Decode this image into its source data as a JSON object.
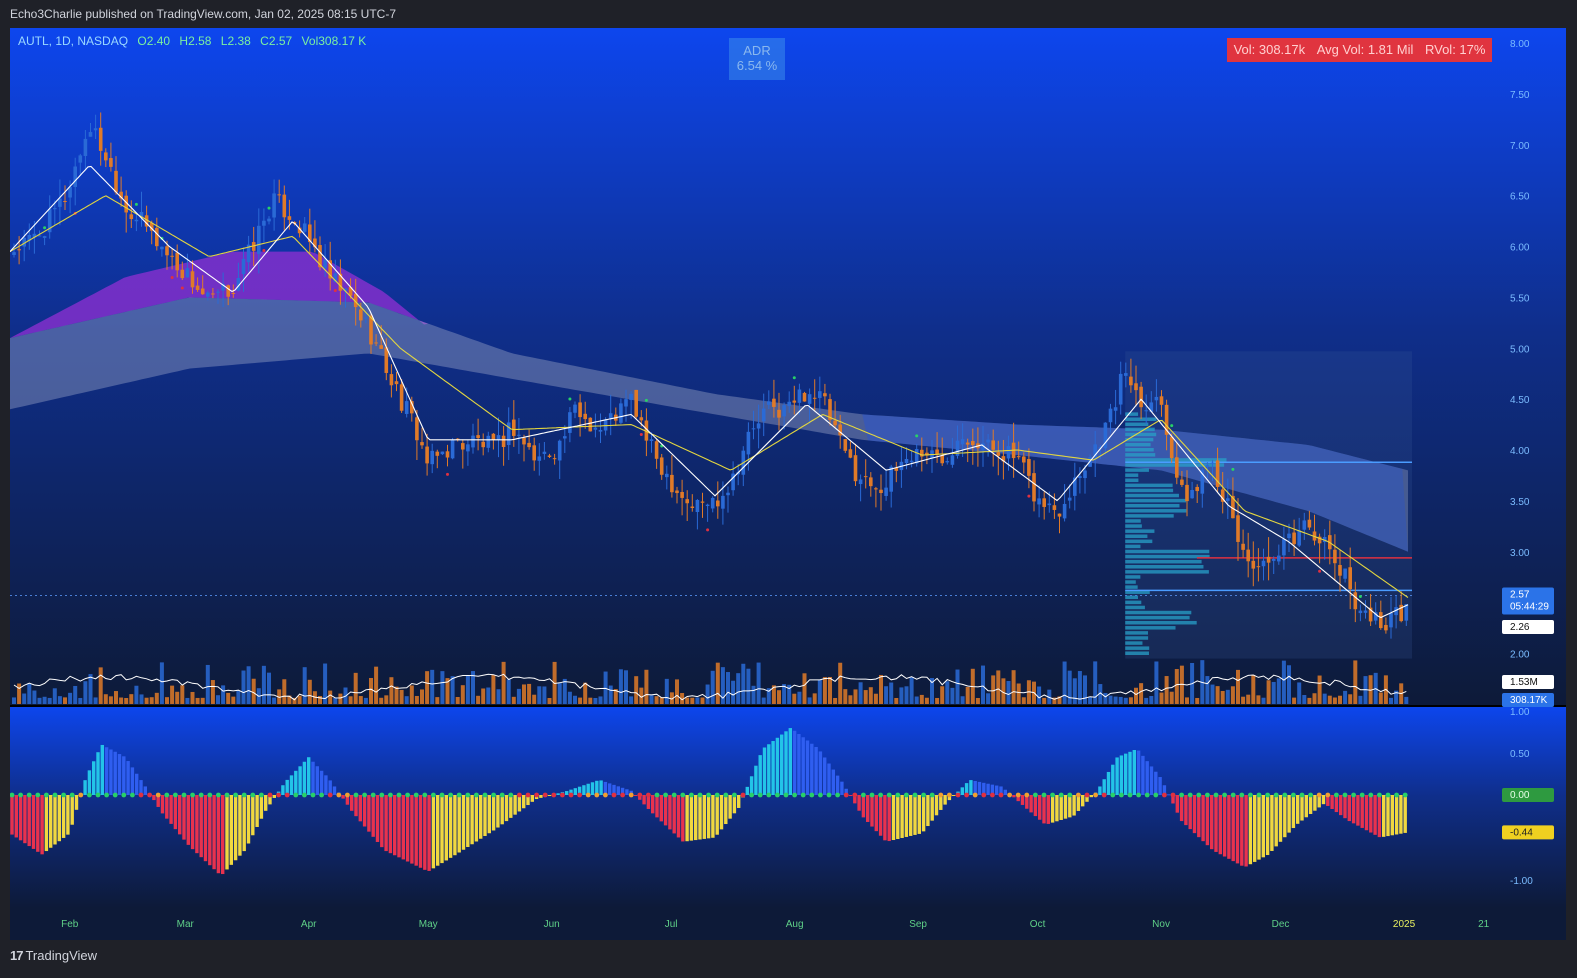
{
  "publisher": "Echo3Charlie published on TradingView.com, Jan 02, 2025 08:15 UTC-7",
  "legend": {
    "symbol": "AUTL, 1D, NASDAQ",
    "open": "O2.40",
    "high": "H2.58",
    "low": "L2.38",
    "close": "C2.57",
    "volume": "Vol308.17 K"
  },
  "adr": {
    "label": "ADR",
    "value": "6.54 %"
  },
  "volume_box": {
    "vol": "Vol: 308.17k",
    "avg": "Avg Vol: 1.81 Mil",
    "rvol": "RVol: 17%"
  },
  "footer": {
    "brand": "TradingView"
  },
  "colors": {
    "up": "#2a6ad6",
    "down": "#e07a28",
    "bg_top": "#0d46ee",
    "bg_bottom": "#0d1a38",
    "ema_fast": "#ffffff",
    "ema_slow": "#e3d640",
    "cloud_purple": "#8a2fd0",
    "cloud_grey": "#9ea8c8",
    "osc_cyan": "#23c4e8",
    "osc_blue": "#2f5ef0",
    "osc_red": "#e8324e",
    "osc_yellow": "#f0d840",
    "vol_profile": "#28a0c8",
    "line_blue": "#4a9cff",
    "line_red": "#e03040",
    "dot_green": "#28d068",
    "dot_red": "#e03040",
    "axis_text": "#7bbcff",
    "month_text": "#5fd088",
    "label_red_bg": "#e0343f"
  },
  "chart_data": [
    {
      "type": "candlestick",
      "title": "",
      "x_ticks": [
        "Feb",
        "Mar",
        "Apr",
        "May",
        "Jun",
        "Jul",
        "Aug",
        "Sep",
        "Oct",
        "Nov",
        "Dec",
        "2025",
        "21"
      ],
      "y_ticks": [
        "8.00",
        "7.50",
        "7.00",
        "6.50",
        "6.00",
        "5.50",
        "5.00",
        "4.50",
        "4.00",
        "3.50",
        "3.00",
        "2.00"
      ],
      "ylim": [
        1.5,
        8.0
      ],
      "price_labels": {
        "last": "2.57",
        "countdown": "05:44:29",
        "level": "2.26"
      },
      "volume_labels": {
        "avg": "1.53M",
        "last": "308.17K"
      },
      "close_path": [
        [
          "2024-01-17",
          5.95
        ],
        [
          "2024-01-22",
          6.05
        ],
        [
          "2024-01-26",
          6.2
        ],
        [
          "2024-01-31",
          6.5
        ],
        [
          "2024-02-06",
          7.2
        ],
        [
          "2024-02-10",
          6.9
        ],
        [
          "2024-02-15",
          6.4
        ],
        [
          "2024-02-20",
          6.2
        ],
        [
          "2024-02-26",
          5.9
        ],
        [
          "2024-03-02",
          5.7
        ],
        [
          "2024-03-07",
          5.45
        ],
        [
          "2024-03-13",
          5.6
        ],
        [
          "2024-03-19",
          6.1
        ],
        [
          "2024-03-23",
          6.45
        ],
        [
          "2024-03-28",
          6.3
        ],
        [
          "2024-04-02",
          6.0
        ],
        [
          "2024-04-06",
          5.7
        ],
        [
          "2024-04-11",
          5.5
        ],
        [
          "2024-04-16",
          5.2
        ],
        [
          "2024-04-20",
          4.85
        ],
        [
          "2024-04-24",
          4.5
        ],
        [
          "2024-04-28",
          4.2
        ],
        [
          "2024-05-01",
          3.85
        ],
        [
          "2024-05-07",
          4.05
        ],
        [
          "2024-05-13",
          4.1
        ],
        [
          "2024-05-18",
          4.0
        ],
        [
          "2024-05-22",
          4.25
        ],
        [
          "2024-05-28",
          3.9
        ],
        [
          "2024-06-03",
          4.05
        ],
        [
          "2024-06-07",
          4.4
        ],
        [
          "2024-06-13",
          4.2
        ],
        [
          "2024-06-17",
          4.35
        ],
        [
          "2024-06-21",
          4.5
        ],
        [
          "2024-06-26",
          4.0
        ],
        [
          "2024-07-01",
          3.7
        ],
        [
          "2024-07-06",
          3.45
        ],
        [
          "2024-07-12",
          3.5
        ],
        [
          "2024-07-16",
          3.7
        ],
        [
          "2024-07-20",
          4.1
        ],
        [
          "2024-07-25",
          4.4
        ],
        [
          "2024-07-30",
          4.4
        ],
        [
          "2024-08-04",
          4.6
        ],
        [
          "2024-08-08",
          4.5
        ],
        [
          "2024-08-13",
          4.0
        ],
        [
          "2024-08-18",
          3.7
        ],
        [
          "2024-08-24",
          3.65
        ],
        [
          "2024-08-28",
          3.9
        ],
        [
          "2024-09-02",
          4.0
        ],
        [
          "2024-09-07",
          3.9
        ],
        [
          "2024-09-12",
          4.2
        ],
        [
          "2024-09-17",
          4.05
        ],
        [
          "2024-09-22",
          4.0
        ],
        [
          "2024-09-26",
          3.9
        ],
        [
          "2024-10-01",
          3.5
        ],
        [
          "2024-10-06",
          3.4
        ],
        [
          "2024-10-10",
          3.7
        ],
        [
          "2024-10-15",
          4.0
        ],
        [
          "2024-10-19",
          4.3
        ],
        [
          "2024-10-23",
          4.8
        ],
        [
          "2024-10-27",
          4.5
        ],
        [
          "2024-11-01",
          4.5
        ],
        [
          "2024-11-06",
          3.55
        ],
        [
          "2024-11-10",
          3.6
        ],
        [
          "2024-11-13",
          4.0
        ],
        [
          "2024-11-18",
          3.4
        ],
        [
          "2024-11-22",
          2.95
        ],
        [
          "2024-11-28",
          2.8
        ],
        [
          "2024-12-03",
          3.1
        ],
        [
          "2024-12-08",
          3.3
        ],
        [
          "2024-12-13",
          3.0
        ],
        [
          "2024-12-17",
          2.75
        ],
        [
          "2024-12-21",
          2.45
        ],
        [
          "2024-12-26",
          2.3
        ],
        [
          "2024-12-31",
          2.38
        ],
        [
          "2025-01-02",
          2.57
        ]
      ],
      "ema_fast_path": [
        [
          "2024-01-17",
          5.95
        ],
        [
          "2024-02-06",
          6.8
        ],
        [
          "2024-02-26",
          6.0
        ],
        [
          "2024-03-13",
          5.55
        ],
        [
          "2024-03-28",
          6.25
        ],
        [
          "2024-04-16",
          5.4
        ],
        [
          "2024-05-01",
          4.1
        ],
        [
          "2024-05-22",
          4.1
        ],
        [
          "2024-06-21",
          4.35
        ],
        [
          "2024-07-12",
          3.55
        ],
        [
          "2024-08-04",
          4.45
        ],
        [
          "2024-08-24",
          3.8
        ],
        [
          "2024-09-17",
          4.05
        ],
        [
          "2024-10-06",
          3.5
        ],
        [
          "2024-10-27",
          4.5
        ],
        [
          "2024-11-18",
          3.45
        ],
        [
          "2024-12-03",
          3.1
        ],
        [
          "2024-12-26",
          2.35
        ],
        [
          "2025-01-02",
          2.48
        ]
      ],
      "ema_slow_path": [
        [
          "2024-01-17",
          5.95
        ],
        [
          "2024-02-10",
          6.5
        ],
        [
          "2024-03-07",
          5.9
        ],
        [
          "2024-03-28",
          6.1
        ],
        [
          "2024-04-24",
          5.0
        ],
        [
          "2024-05-22",
          4.2
        ],
        [
          "2024-06-21",
          4.25
        ],
        [
          "2024-07-16",
          3.8
        ],
        [
          "2024-08-08",
          4.35
        ],
        [
          "2024-09-02",
          3.95
        ],
        [
          "2024-09-26",
          4.0
        ],
        [
          "2024-10-15",
          3.9
        ],
        [
          "2024-11-01",
          4.3
        ],
        [
          "2024-11-22",
          3.4
        ],
        [
          "2024-12-13",
          3.1
        ],
        [
          "2025-01-02",
          2.55
        ]
      ],
      "cloud_purple_path": [
        [
          "2024-01-17",
          5.1
        ],
        [
          "2024-02-15",
          5.7
        ],
        [
          "2024-03-13",
          5.95
        ],
        [
          "2024-04-02",
          5.95
        ],
        [
          "2024-04-20",
          5.55
        ],
        [
          "2024-05-01",
          5.2
        ]
      ],
      "cloud_upper_path": [
        [
          "2024-01-17",
          5.1
        ],
        [
          "2024-03-02",
          5.5
        ],
        [
          "2024-04-16",
          5.45
        ],
        [
          "2024-05-22",
          4.95
        ],
        [
          "2024-07-12",
          4.55
        ],
        [
          "2024-08-18",
          4.35
        ],
        [
          "2024-09-26",
          4.25
        ],
        [
          "2024-11-01",
          4.2
        ],
        [
          "2024-12-08",
          4.05
        ],
        [
          "2025-01-02",
          3.8
        ]
      ],
      "cloud_lower_path": [
        [
          "2024-01-17",
          4.4
        ],
        [
          "2024-03-02",
          4.8
        ],
        [
          "2024-04-16",
          4.95
        ],
        [
          "2024-05-22",
          4.7
        ],
        [
          "2024-07-12",
          4.35
        ],
        [
          "2024-08-18",
          4.1
        ],
        [
          "2024-09-26",
          3.95
        ],
        [
          "2024-11-01",
          3.8
        ],
        [
          "2024-12-08",
          3.4
        ],
        [
          "2025-01-02",
          3.0
        ]
      ],
      "horizontal_levels": [
        {
          "price": 3.88,
          "color": "line_blue",
          "from": "2024-10-23"
        },
        {
          "price": 2.94,
          "color": "line_red",
          "from": "2024-11-10"
        },
        {
          "price": 2.62,
          "color": "line_blue",
          "from": "2024-10-23"
        }
      ]
    },
    {
      "type": "bar",
      "title": "",
      "y_ticks": [
        "1.00",
        "0.50",
        "0.00",
        "-1.00"
      ],
      "ylim": [
        -1.25,
        1.0
      ],
      "current_labels": {
        "zero": "0.00",
        "value": "-0.44"
      },
      "histogram_path": [
        [
          "2024-01-17",
          -0.45
        ],
        [
          "2024-01-25",
          -0.7
        ],
        [
          "2024-02-01",
          -0.45
        ],
        [
          "2024-02-05",
          0.2
        ],
        [
          "2024-02-09",
          0.6
        ],
        [
          "2024-02-15",
          0.45
        ],
        [
          "2024-02-20",
          0.1
        ],
        [
          "2024-02-24",
          -0.2
        ],
        [
          "2024-03-02",
          -0.6
        ],
        [
          "2024-03-10",
          -0.95
        ],
        [
          "2024-03-16",
          -0.65
        ],
        [
          "2024-03-21",
          -0.2
        ],
        [
          "2024-03-26",
          0.15
        ],
        [
          "2024-04-01",
          0.45
        ],
        [
          "2024-04-06",
          0.2
        ],
        [
          "2024-04-12",
          -0.2
        ],
        [
          "2024-04-20",
          -0.65
        ],
        [
          "2024-05-01",
          -0.9
        ],
        [
          "2024-05-08",
          -0.7
        ],
        [
          "2024-05-18",
          -0.4
        ],
        [
          "2024-05-28",
          -0.05
        ],
        [
          "2024-06-05",
          0.05
        ],
        [
          "2024-06-13",
          0.18
        ],
        [
          "2024-06-21",
          0.05
        ],
        [
          "2024-06-26",
          -0.2
        ],
        [
          "2024-07-04",
          -0.55
        ],
        [
          "2024-07-12",
          -0.5
        ],
        [
          "2024-07-18",
          -0.15
        ],
        [
          "2024-07-24",
          0.55
        ],
        [
          "2024-07-31",
          0.8
        ],
        [
          "2024-08-07",
          0.55
        ],
        [
          "2024-08-13",
          0.15
        ],
        [
          "2024-08-18",
          -0.25
        ],
        [
          "2024-08-24",
          -0.55
        ],
        [
          "2024-09-02",
          -0.45
        ],
        [
          "2024-09-08",
          -0.1
        ],
        [
          "2024-09-14",
          0.18
        ],
        [
          "2024-09-22",
          0.1
        ],
        [
          "2024-09-28",
          -0.15
        ],
        [
          "2024-10-03",
          -0.35
        ],
        [
          "2024-10-10",
          -0.25
        ],
        [
          "2024-10-16",
          0.05
        ],
        [
          "2024-10-21",
          0.45
        ],
        [
          "2024-10-26",
          0.55
        ],
        [
          "2024-11-01",
          0.2
        ],
        [
          "2024-11-06",
          -0.3
        ],
        [
          "2024-11-14",
          -0.65
        ],
        [
          "2024-11-22",
          -0.85
        ],
        [
          "2024-11-28",
          -0.7
        ],
        [
          "2024-12-05",
          -0.35
        ],
        [
          "2024-12-12",
          -0.1
        ],
        [
          "2024-12-18",
          -0.3
        ],
        [
          "2024-12-26",
          -0.5
        ],
        [
          "2025-01-02",
          -0.44
        ]
      ]
    }
  ]
}
